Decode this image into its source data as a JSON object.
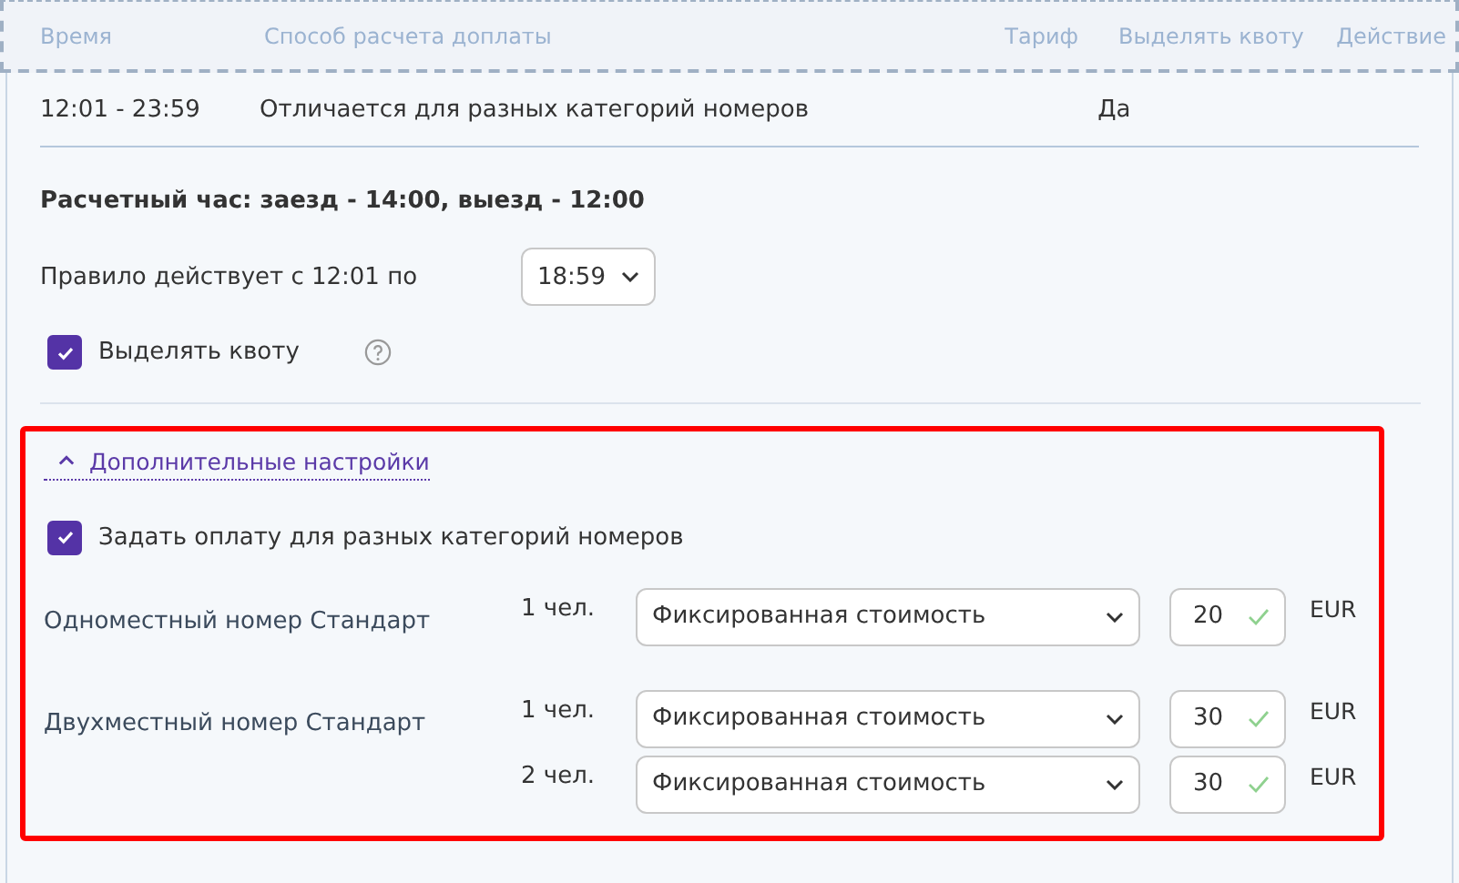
{
  "table": {
    "columns": [
      "Время",
      "Способ расчета доплаты",
      "Тариф",
      "Выделять квоту",
      "Действие"
    ],
    "rows": [
      [
        "12:01 - 23:59",
        "Отличается для разных категорий номеров",
        "",
        "Да",
        ""
      ]
    ]
  },
  "checkout_title": "Расчетный час: заезд - 14:00, выезд - 12:00",
  "rule": {
    "label": "Правило действует с 12:01 по",
    "value": "18:59"
  },
  "quota": {
    "label": "Выделять квоту",
    "checked": true
  },
  "advanced": {
    "label": "Дополнительные настройки",
    "expanded": true,
    "per_category": {
      "label": "Задать оплату для разных категорий номеров",
      "checked": true
    },
    "categories": [
      {
        "name": "Одноместный номер Стандарт",
        "rows": [
          {
            "persons": "1 чел.",
            "method": "Фиксированная стоимость",
            "amount": "20",
            "valid": true,
            "currency": "EUR"
          }
        ]
      },
      {
        "name": "Двухместный номер Стандарт",
        "rows": [
          {
            "persons": "1 чел.",
            "method": "Фиксированная стоимость",
            "amount": "30",
            "valid": true,
            "currency": "EUR"
          },
          {
            "persons": "2 чел.",
            "method": "Фиксированная стоимость",
            "amount": "30",
            "valid": true,
            "currency": "EUR"
          }
        ]
      }
    ]
  }
}
